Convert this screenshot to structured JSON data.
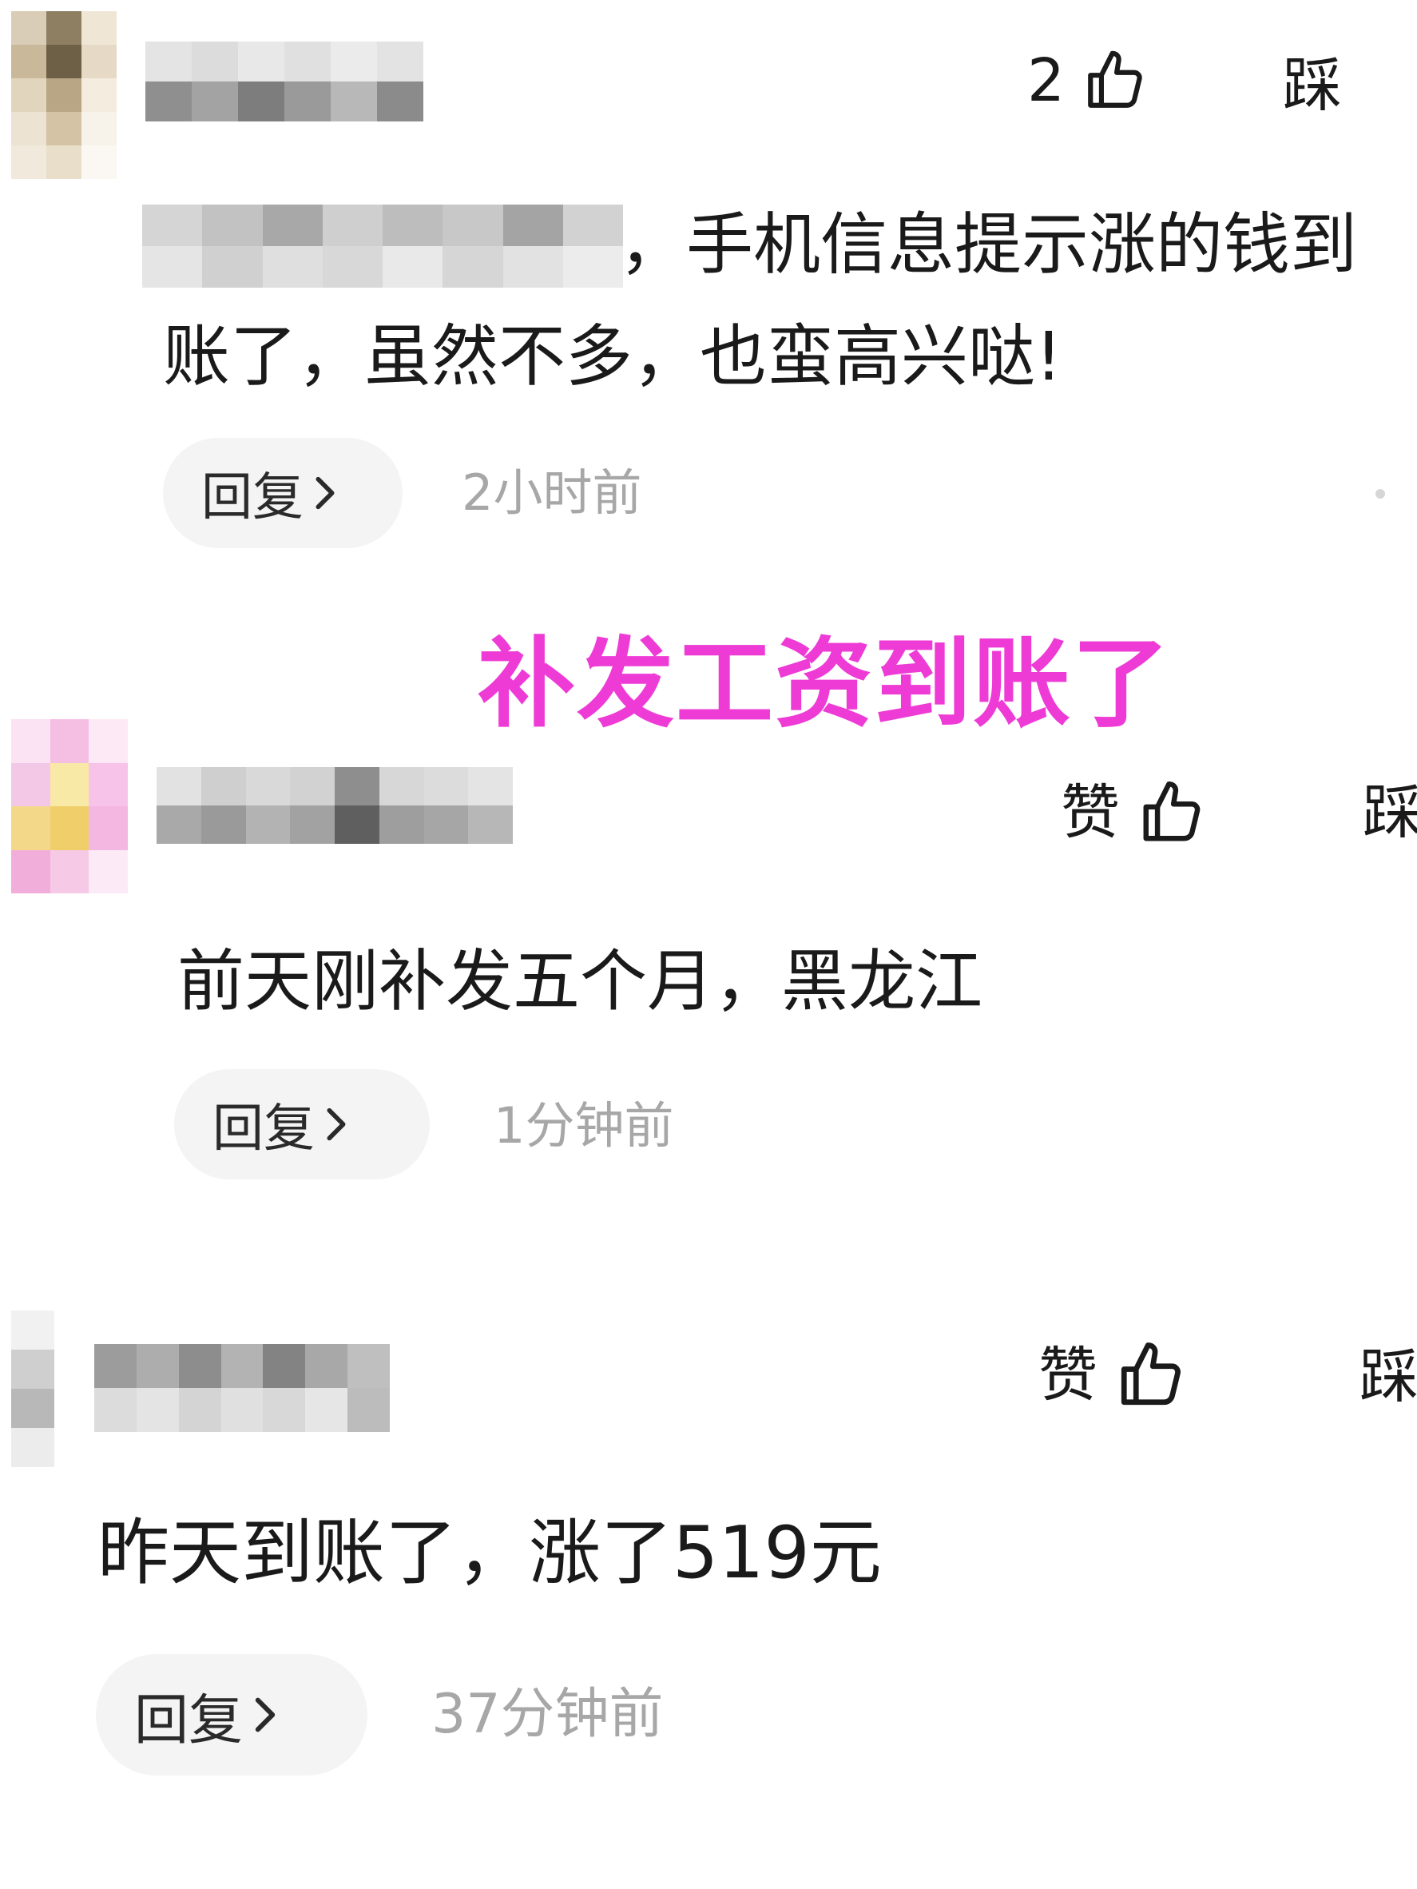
{
  "overlay_title": "补发工资到账了",
  "comments": [
    {
      "like_label": "2",
      "dislike_label": "踩",
      "text_line1_suffix": "，手机信息提示涨的钱到",
      "text_line2": "账了，虽然不多，也蛮高兴哒!",
      "reply_label": "回复",
      "time": "2小时前"
    },
    {
      "like_label": "赞",
      "dislike_label": "踩",
      "text": "前天刚补发五个月，黑龙江",
      "reply_label": "回复",
      "time": "1分钟前"
    },
    {
      "like_label": "赞",
      "dislike_label": "踩",
      "text": "昨天到账了，涨了519元",
      "reply_label": "回复",
      "time": "37分钟前"
    }
  ],
  "icons": {
    "like": "thumbs-up-outline-icon",
    "reply_chevron": "chevron-right-icon"
  },
  "colors": {
    "overlay": "#ee3bd6",
    "time": "#a7a7a7",
    "reply_bg": "#f4f4f4"
  }
}
